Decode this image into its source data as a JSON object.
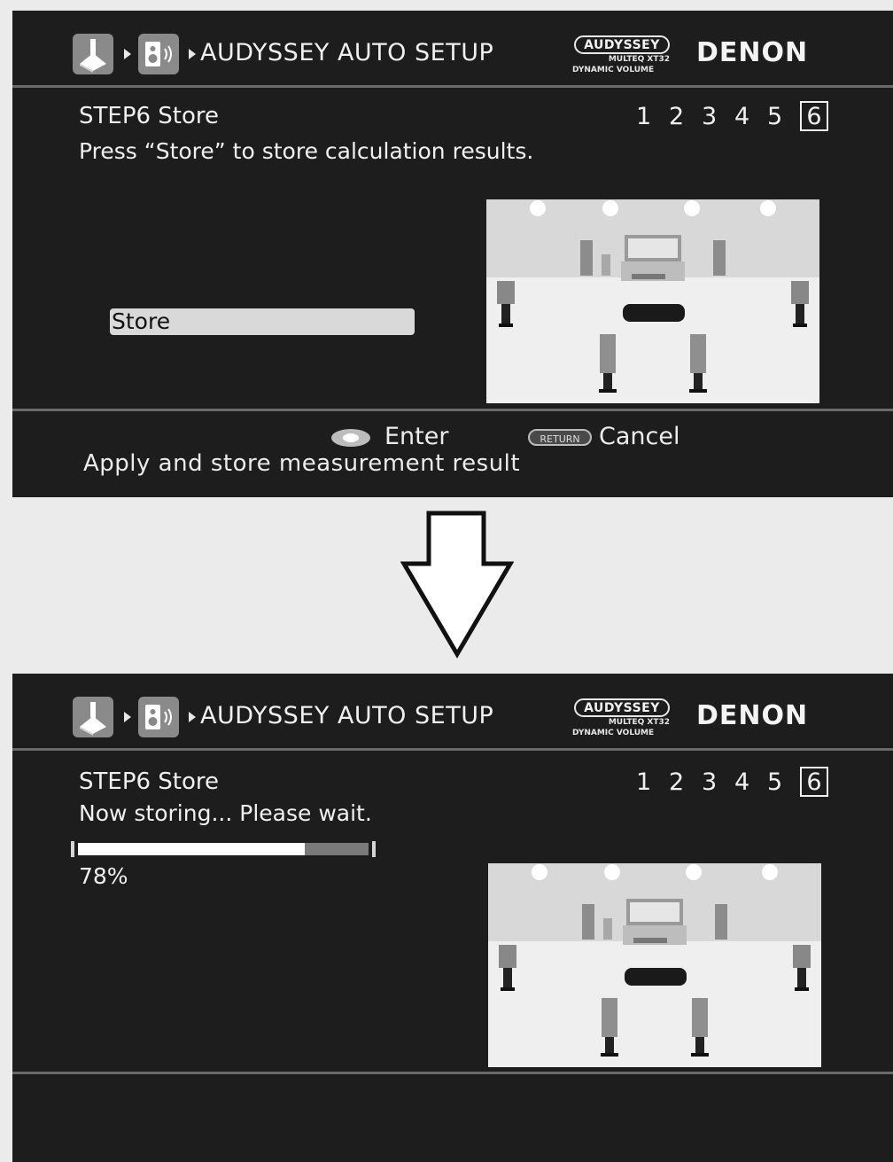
{
  "screens": [
    {
      "header": {
        "title": "AUDYSSEY AUTO SETUP",
        "logo_line1": "AUDYSSEY",
        "logo_line2": "MULTEQ XT32",
        "logo_line3": "DYNAMIC VOLUME",
        "brand": "DENON"
      },
      "step_title": "STEP6 Store",
      "message": "Press “Store” to store calculation results.",
      "steps": [
        "1",
        "2",
        "3",
        "4",
        "5",
        "6"
      ],
      "current_step": "6",
      "store_button": "Store",
      "footer": {
        "enter_label": "Enter",
        "return_key": "RETURN",
        "cancel_label": "Cancel",
        "hint": "Apply and store measurement result"
      }
    },
    {
      "header": {
        "title": "AUDYSSEY AUTO SETUP",
        "logo_line1": "AUDYSSEY",
        "logo_line2": "MULTEQ XT32",
        "logo_line3": "DYNAMIC VOLUME",
        "brand": "DENON"
      },
      "step_title": "STEP6 Store",
      "message": "Now storing... Please wait.",
      "steps": [
        "1",
        "2",
        "3",
        "4",
        "5",
        "6"
      ],
      "current_step": "6",
      "progress_value": 0.78,
      "progress_label": "78%"
    }
  ],
  "icons": {
    "setup": "setup-icon",
    "speaker": "speaker-setup-icon",
    "enter": "enter-cursor-icon",
    "arrow": "down-arrow-icon"
  },
  "colors": {
    "screen_bg": "#1d1d1d",
    "page_bg": "#ebebeb",
    "text": "#ececec",
    "divider": "#6a6a6a"
  }
}
